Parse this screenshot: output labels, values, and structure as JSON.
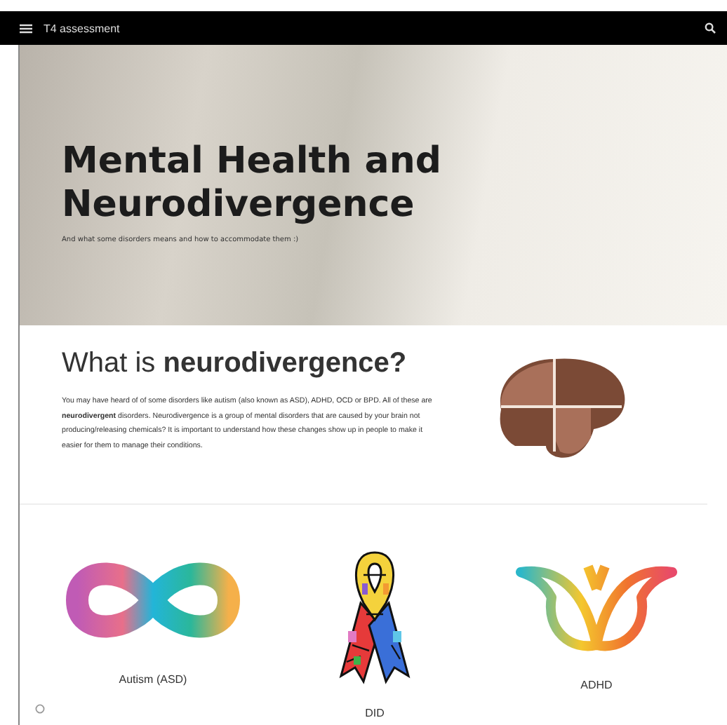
{
  "top_bar": {
    "title": "T4 assessment"
  },
  "hero": {
    "title": "Mental Health and Neurodivergence",
    "subtitle": "And what some disorders means and how to accommodate them :)"
  },
  "intro": {
    "heading": "What is **neurodivergence?**",
    "text": "You may have heard of of some disorders like autism (also known as ASD), ADHD, OCD or BPD. All of these are **neurodivergent** disorders. Neurodivergence is a group of mental disorders that are caused by your brain not producing/releasing chemicals? It is important to understand how these changes show up in people to make it easier for them to manage their conditions."
  },
  "disorders": [
    {
      "kind": "infinity",
      "label": "Autism (ASD)"
    },
    {
      "kind": "ribbon",
      "label": "DID"
    },
    {
      "kind": "butterfly",
      "label": "ADHD"
    }
  ]
}
